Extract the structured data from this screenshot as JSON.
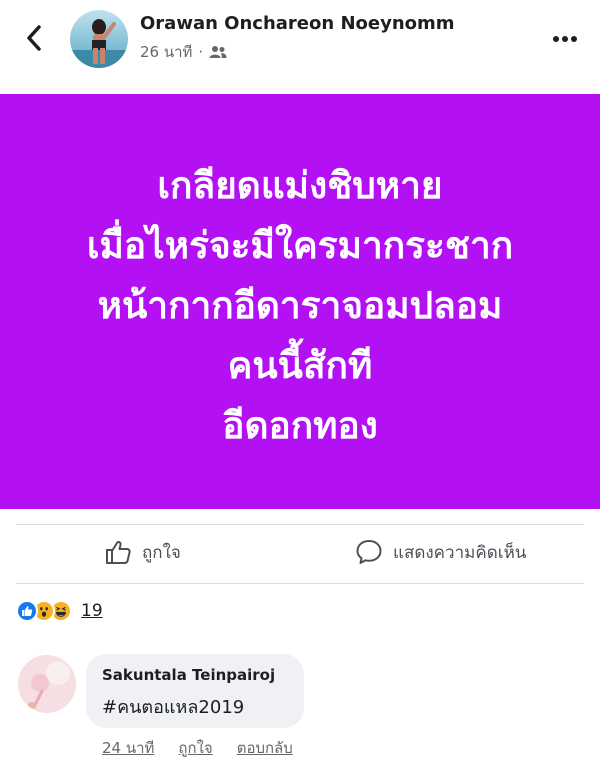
{
  "header": {
    "author": "Orawan Onchareon Noeynomm",
    "time": "26 นาที",
    "separator": "·",
    "back_icon": "chevron-left-icon",
    "audience_icon": "friends-icon",
    "more_icon": "more-horizontal-icon"
  },
  "post": {
    "background_color": "#b410f4",
    "lines": [
      "เกลียดแม่งชิบหาย",
      "เมื่อไหร่จะมีใครมากระชาก",
      "หน้ากากอีดาราจอมปลอม",
      "คนนี้สักที",
      "อีดอกทอง"
    ]
  },
  "actions": {
    "like_label": "ถูกใจ",
    "comment_label": "แสดงความคิดเห็น"
  },
  "reactions": {
    "types": [
      "like",
      "wow",
      "haha"
    ],
    "count": "19"
  },
  "comment": {
    "author": "Sakuntala Teinpairoj",
    "text": "#คนตอแหล2019",
    "time": "24 นาที",
    "like_label": "ถูกใจ",
    "reply_label": "ตอบกลับ"
  }
}
